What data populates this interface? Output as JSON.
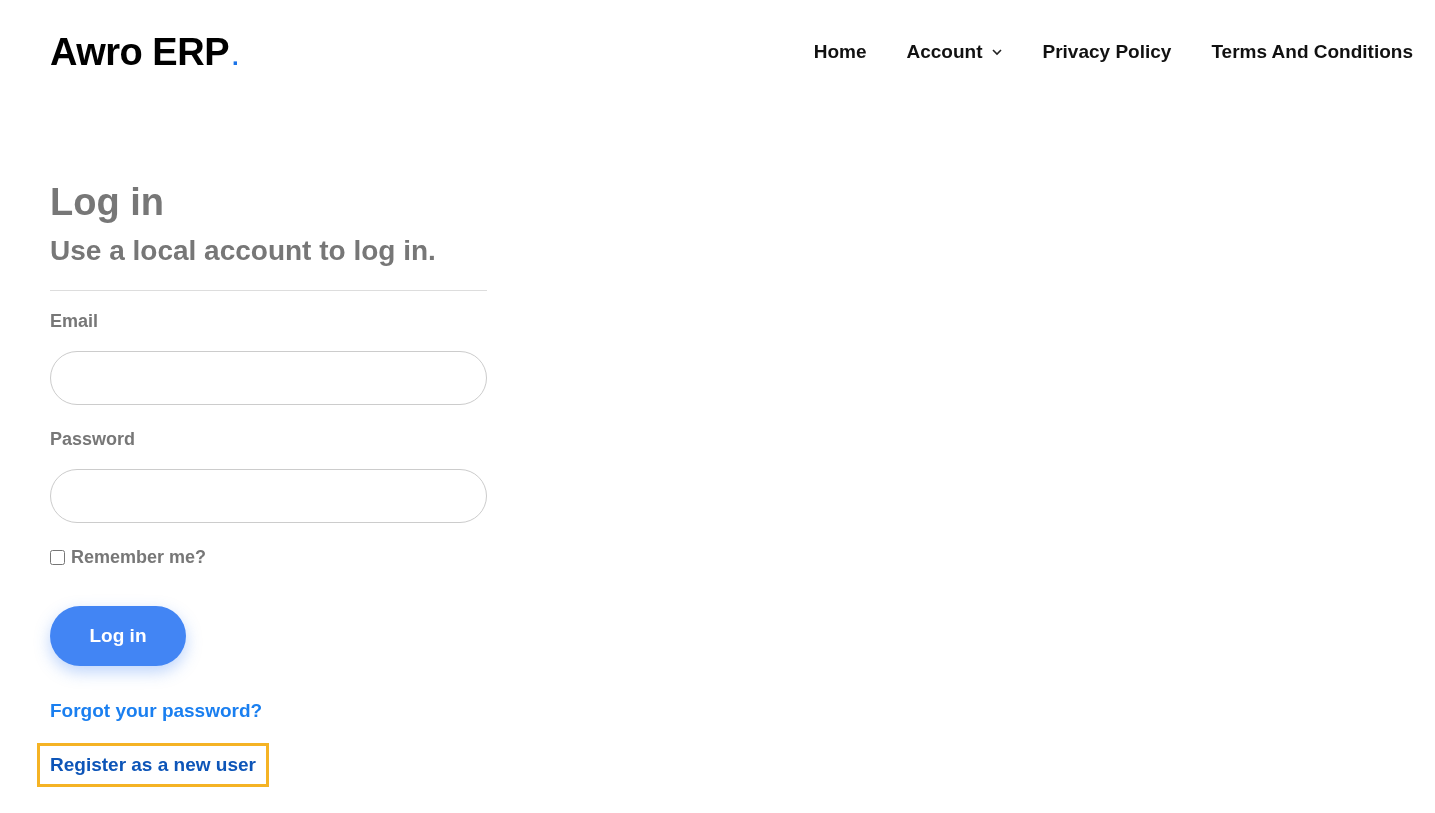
{
  "logo": {
    "text": "Awro ERP",
    "dot": "."
  },
  "nav": [
    {
      "label": "Home",
      "dropdown": false
    },
    {
      "label": "Account",
      "dropdown": true
    },
    {
      "label": "Privacy Policy",
      "dropdown": false
    },
    {
      "label": "Terms And Conditions",
      "dropdown": false
    }
  ],
  "title": "Log in",
  "subtitle": "Use a local account to log in.",
  "fields": [
    {
      "label": "Email"
    },
    {
      "label": "Password"
    }
  ],
  "remember": {
    "label": "Remember me?",
    "checked": false
  },
  "submit": "Log in",
  "links": [
    {
      "label": "Forgot your password?",
      "focused": false
    },
    {
      "label": "Register as a new user",
      "focused": true
    }
  ]
}
